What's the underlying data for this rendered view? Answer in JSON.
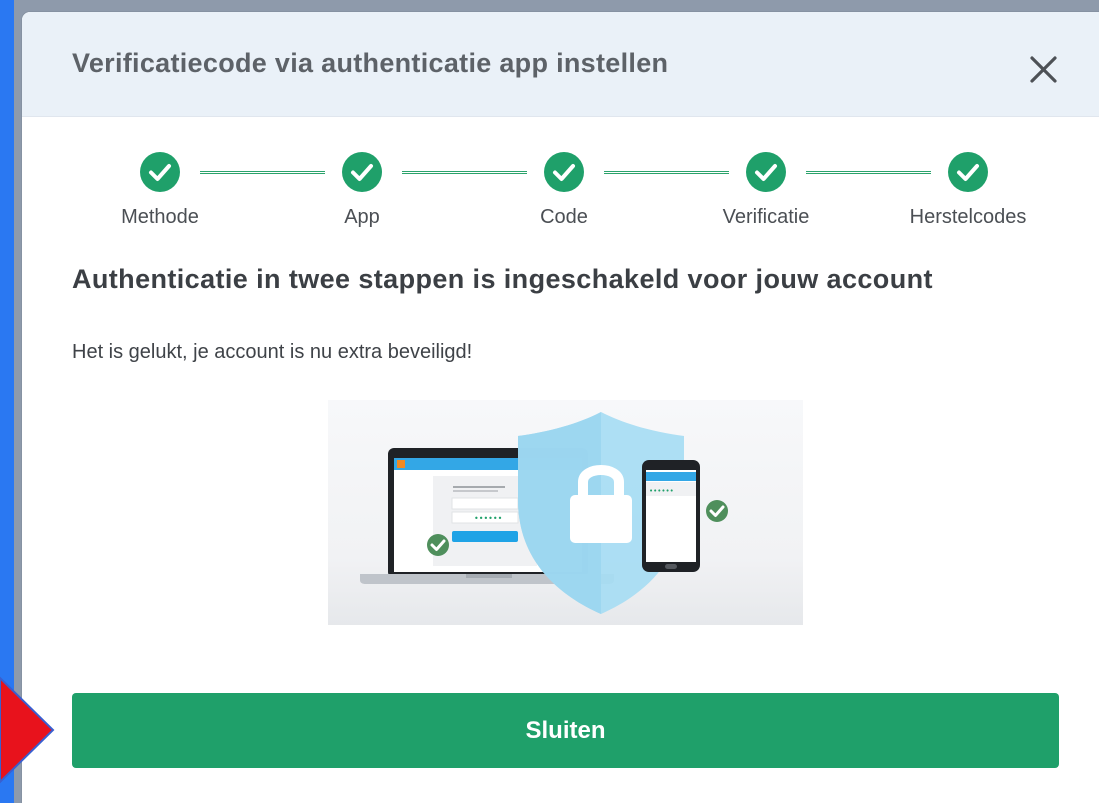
{
  "modal": {
    "title": "Verificatiecode via authenticatie app instellen",
    "close_icon": "close-icon"
  },
  "stepper": {
    "steps": [
      {
        "label": "Methode",
        "status": "completed"
      },
      {
        "label": "App",
        "status": "completed"
      },
      {
        "label": "Code",
        "status": "completed"
      },
      {
        "label": "Verificatie",
        "status": "completed"
      },
      {
        "label": "Herstelcodes",
        "status": "completed"
      }
    ]
  },
  "content": {
    "heading": "Authenticatie in twee stappen is ingeschakeld voor jouw account",
    "message": "Het is gelukt, je account is nu extra beveiligd!",
    "illustration": "laptop-phone-shield-lock-illustration",
    "password_dots": "••••••"
  },
  "footer": {
    "close_label": "Sluiten"
  },
  "colors": {
    "accent": "#1fa06a",
    "header_bg": "#eaf1f8",
    "page_bg": "#1a6df0",
    "pointer": "#e8121c"
  }
}
